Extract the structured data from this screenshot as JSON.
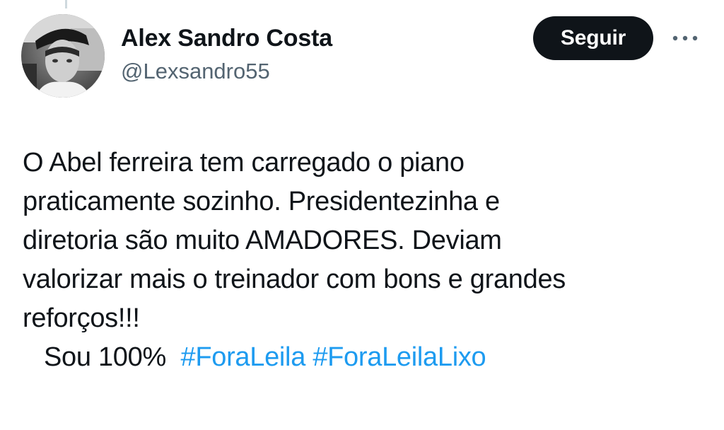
{
  "tweet": {
    "author": {
      "display_name": "Alex Sandro Costa",
      "handle": "@Lexsandro55"
    },
    "follow_label": "Seguir",
    "more_icon": "more-horizontal-icon",
    "text_lines": [
      "O Abel ferreira tem carregado o piano",
      "praticamente sozinho. Presidentezinha e",
      "diretoria são muito AMADORES. Deviam",
      "valorizar mais o treinador com bons e grandes",
      "reforços!!!"
    ],
    "last_line": {
      "text": "Sou 100%",
      "hashtags": [
        "#ForaLeila",
        "#ForaLeilaLixo"
      ]
    },
    "colors": {
      "text": "#0f1419",
      "secondary": "#536471",
      "hashtag": "#1d9bf0",
      "button_bg": "#0f1419",
      "button_text": "#ffffff"
    }
  }
}
